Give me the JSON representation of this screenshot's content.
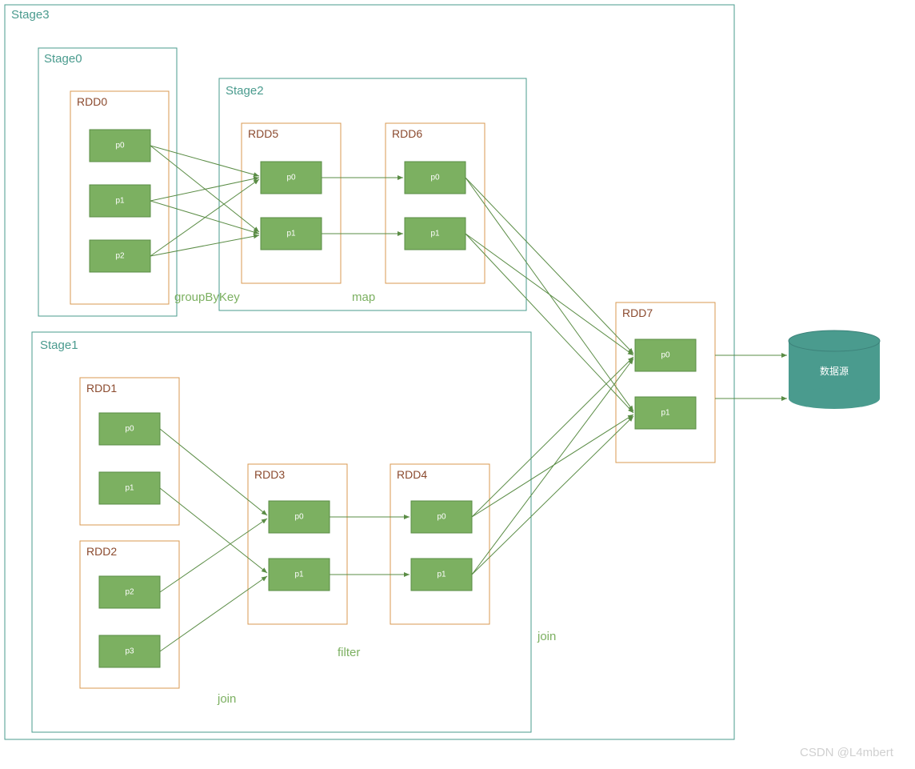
{
  "stages": {
    "outer": "Stage3",
    "s0": "Stage0",
    "s1": "Stage1",
    "s2": "Stage2"
  },
  "rdds": {
    "r0": "RDD0",
    "r1": "RDD1",
    "r2": "RDD2",
    "r3": "RDD3",
    "r4": "RDD4",
    "r5": "RDD5",
    "r6": "RDD6",
    "r7": "RDD7"
  },
  "parts": {
    "p0": "p0",
    "p1": "p1",
    "p2": "p2",
    "p3": "p3"
  },
  "ops": {
    "groupByKey": "groupByKey",
    "map": "map",
    "filter": "filter",
    "joinTop": "join",
    "joinRight": "join"
  },
  "sink": "数据源",
  "watermark": "CSDN @L4mbert",
  "diagram": {
    "description": "Spark DAG showing RDD lineage across 4 stages",
    "stages": [
      {
        "id": "Stage3",
        "contains": [
          "Stage0",
          "Stage1",
          "Stage2",
          "RDD7"
        ]
      },
      {
        "id": "Stage0",
        "rdds": [
          "RDD0"
        ]
      },
      {
        "id": "Stage2",
        "rdds": [
          "RDD5",
          "RDD6"
        ]
      },
      {
        "id": "Stage1",
        "rdds": [
          "RDD1",
          "RDD2",
          "RDD3",
          "RDD4"
        ]
      }
    ],
    "rdds": [
      {
        "id": "RDD0",
        "partitions": [
          "p0",
          "p1",
          "p2"
        ]
      },
      {
        "id": "RDD1",
        "partitions": [
          "p0",
          "p1"
        ]
      },
      {
        "id": "RDD2",
        "partitions": [
          "p2",
          "p3"
        ]
      },
      {
        "id": "RDD3",
        "partitions": [
          "p0",
          "p1"
        ]
      },
      {
        "id": "RDD4",
        "partitions": [
          "p0",
          "p1"
        ]
      },
      {
        "id": "RDD5",
        "partitions": [
          "p0",
          "p1"
        ]
      },
      {
        "id": "RDD6",
        "partitions": [
          "p0",
          "p1"
        ]
      },
      {
        "id": "RDD7",
        "partitions": [
          "p0",
          "p1"
        ]
      }
    ],
    "edges": [
      {
        "from": "RDD0",
        "to": "RDD5",
        "op": "groupByKey",
        "type": "shuffle"
      },
      {
        "from": "RDD5",
        "to": "RDD6",
        "op": "map",
        "type": "narrow"
      },
      {
        "from": "RDD1",
        "to": "RDD3",
        "op": "join",
        "type": "narrow"
      },
      {
        "from": "RDD2",
        "to": "RDD3",
        "op": "join",
        "type": "narrow"
      },
      {
        "from": "RDD3",
        "to": "RDD4",
        "op": "filter",
        "type": "narrow"
      },
      {
        "from": "RDD6",
        "to": "RDD7",
        "op": "join",
        "type": "shuffle"
      },
      {
        "from": "RDD4",
        "to": "RDD7",
        "op": "join",
        "type": "shuffle"
      },
      {
        "from": "RDD7",
        "to": "数据源",
        "op": "save",
        "type": "action"
      }
    ]
  }
}
